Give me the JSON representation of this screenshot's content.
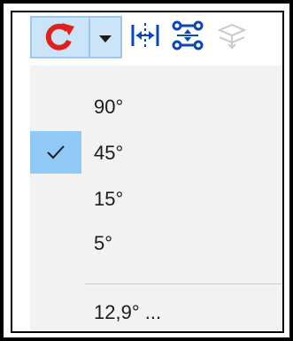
{
  "toolbar": {
    "rotate_button": {
      "icon": "rotate-icon",
      "color": "#e0201b"
    },
    "rotate_dropdown": {
      "icon": "dropdown-arrow-icon"
    },
    "tools": [
      {
        "name": "flip-horizontal-icon",
        "color": "#0a46b5"
      },
      {
        "name": "align-icon",
        "color": "#0a46b5"
      },
      {
        "name": "layers-icon",
        "color": "#c9c9c9"
      }
    ]
  },
  "menu": {
    "items": [
      {
        "label": "90°",
        "checked": false
      },
      {
        "label": "45°",
        "checked": true
      },
      {
        "label": "15°",
        "checked": false
      },
      {
        "label": "5°",
        "checked": false
      }
    ],
    "custom_item": {
      "label": "12,9° ..."
    }
  },
  "colors": {
    "selected_bg": "#90c8f6",
    "hover_button_bg": "#cce4f7",
    "menu_bg": "#f2f2f2"
  }
}
